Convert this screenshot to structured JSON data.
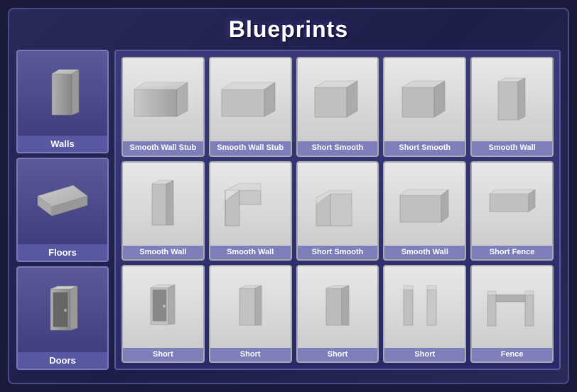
{
  "title": "Blueprints",
  "sidebar": {
    "items": [
      {
        "id": "walls",
        "label": "Walls"
      },
      {
        "id": "floors",
        "label": "Floors"
      },
      {
        "id": "doors",
        "label": "Doors"
      }
    ]
  },
  "grid": {
    "rows": [
      [
        {
          "id": "smooth-wall-stub-1",
          "label": "Smooth Wall Stub"
        },
        {
          "id": "smooth-wall-stub-2",
          "label": "Smooth Wall Stub"
        },
        {
          "id": "short-smooth-1",
          "label": "Short Smooth"
        },
        {
          "id": "short-smooth-2",
          "label": "Short Smooth"
        },
        {
          "id": "smooth-wall-1",
          "label": "Smooth Wall"
        }
      ],
      [
        {
          "id": "smooth-wall-2",
          "label": "Smooth Wall"
        },
        {
          "id": "smooth-wall-3",
          "label": "Smooth Wall"
        },
        {
          "id": "short-smooth-3",
          "label": "Short Smooth"
        },
        {
          "id": "smooth-wall-4",
          "label": "Smooth Wall"
        },
        {
          "id": "short-fence-1",
          "label": "Short Fence"
        }
      ],
      [
        {
          "id": "short-1",
          "label": "Short"
        },
        {
          "id": "short-2",
          "label": "Short"
        },
        {
          "id": "short-3",
          "label": "Short"
        },
        {
          "id": "short-4",
          "label": "Short"
        },
        {
          "id": "fence-1",
          "label": "Fence"
        }
      ]
    ]
  }
}
